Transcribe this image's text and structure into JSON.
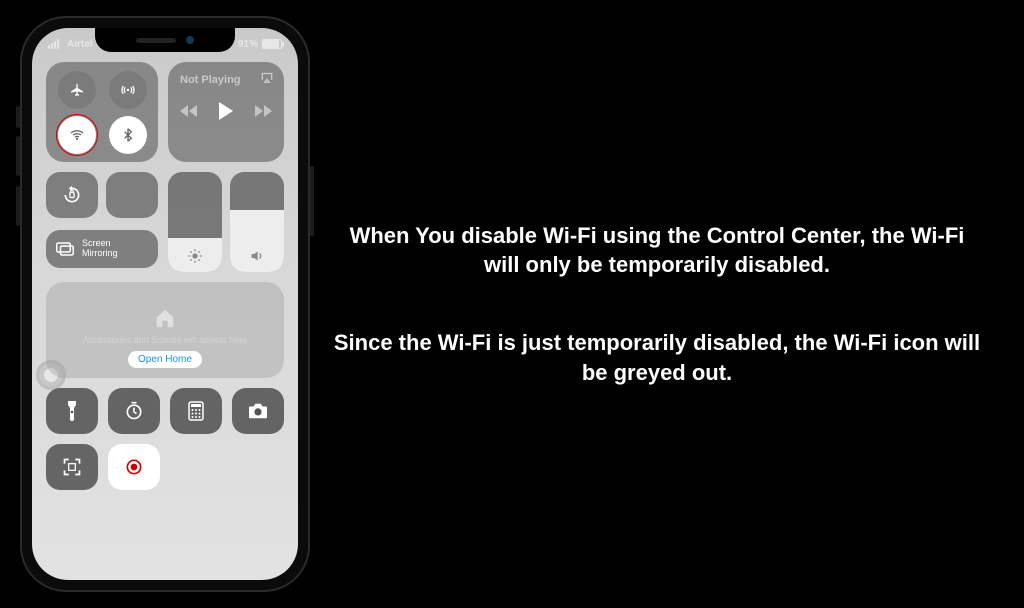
{
  "status": {
    "carrier": "Airtel",
    "battery_pct": "91%"
  },
  "media": {
    "not_playing": "Not Playing"
  },
  "mirroring": {
    "label": "Screen\nMirroring"
  },
  "home": {
    "subtitle": "Accessories and Scenes will appear here",
    "open": "Open Home"
  },
  "caption": {
    "p1": "When You disable Wi-Fi using the Control Center, the Wi-Fi will only be temporarily disabled.",
    "p2": "Since the Wi-Fi is just temporarily disabled, the Wi-Fi icon will be greyed out."
  },
  "icons": {
    "airplane": "airplane-icon",
    "cellular": "cellular-antenna-icon",
    "wifi": "wifi-icon",
    "bluetooth": "bluetooth-icon",
    "airplay": "airplay-icon",
    "play": "play-icon",
    "prev": "previous-track-icon",
    "next": "next-track-icon",
    "orientation": "orientation-lock-icon",
    "dnd": "do-not-disturb-moon-icon",
    "mirror": "screen-mirroring-icon",
    "brightness": "brightness-sun-icon",
    "volume": "volume-speaker-icon",
    "home": "house-icon",
    "flashlight": "flashlight-icon",
    "timer": "timer-icon",
    "calculator": "calculator-icon",
    "camera": "camera-icon",
    "qr": "qr-scan-icon",
    "record": "screen-record-icon"
  }
}
